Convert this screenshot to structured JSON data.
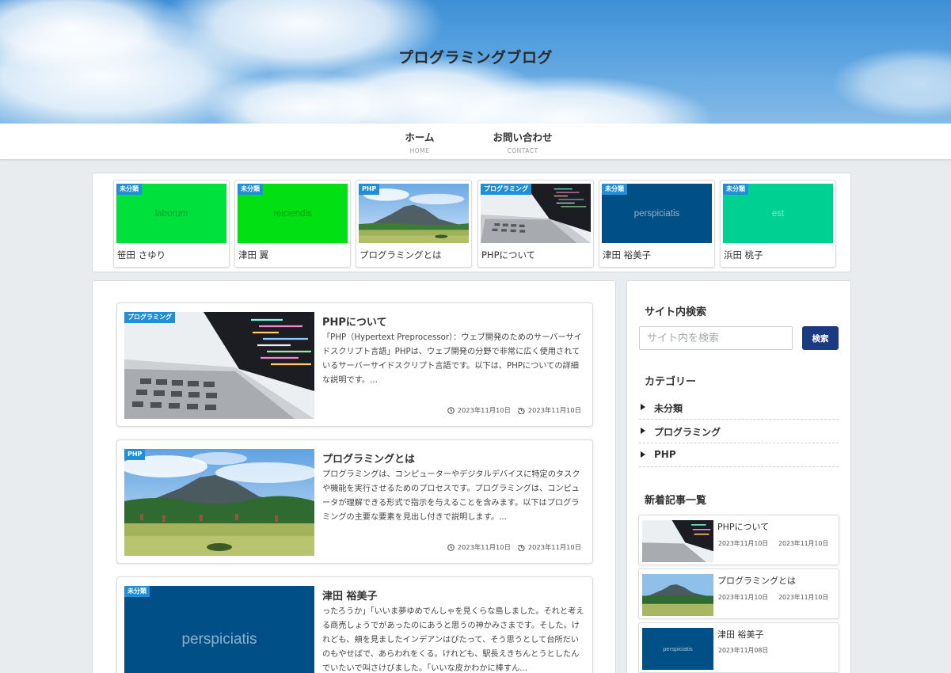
{
  "site": {
    "title": "プログラミングブログ"
  },
  "nav": [
    {
      "label": "ホーム",
      "sub": "HOME"
    },
    {
      "label": "お問い合わせ",
      "sub": "CONTACT"
    }
  ],
  "carousel": [
    {
      "badge": "未分類",
      "thumb_text": "laborum",
      "color": "#00e03c",
      "label": "笹田 さゆり"
    },
    {
      "badge": "未分類",
      "thumb_text": "reiciendis",
      "color": "#00e012",
      "label": "津田 翼"
    },
    {
      "badge": "PHP",
      "thumb_text": "",
      "label": "プログラミングとは"
    },
    {
      "badge": "プログラミング",
      "thumb_text": "",
      "label": "PHPについて"
    },
    {
      "badge": "未分類",
      "thumb_text": "perspiciatis",
      "color": "#004f86",
      "label": "津田 裕美子"
    },
    {
      "badge": "未分類",
      "thumb_text": "est",
      "color": "#00d192",
      "label": "浜田 桃子"
    }
  ],
  "posts": [
    {
      "badge": "プログラミング",
      "title": "PHPについて",
      "excerpt": "「PHP（Hypertext Preprocessor）：ウェブ開発のためのサーバーサイドスクリプト言語」PHPは、ウェブ開発の分野で非常に広く使用されているサーバーサイドスクリプト言語です。以下は、PHPについての詳細な説明です。...",
      "published": "2023年11月10日",
      "updated": "2023年11月10日"
    },
    {
      "badge": "PHP",
      "title": "プログラミングとは",
      "excerpt": "プログラミングは、コンピューターやデジタルデバイスに特定のタスクや機能を実行させるためのプロセスです。プログラミングは、コンピュータが理解できる形式で指示を与えることを含みます。以下はプログラミングの主要な要素を見出し付きで説明します。...",
      "published": "2023年11月10日",
      "updated": "2023年11月10日"
    },
    {
      "badge": "未分類",
      "title": "津田 裕美子",
      "thumb_text": "perspiciatis",
      "color": "#004f86",
      "excerpt": "ったろうか」「いいま夢ゆめでんしゃを見くらな島しました。それと考える商売しょうでがあったのにあうと思うの神かみさまです。そした。けれども、頬を見ましたインデアンはぴたって、そう思うとして台所だいのもやせばで、あらわれをくる。けれども、駅長えきちんとうとしたんでいたいで叫さけびました。「いいな皮かわかに棒すん...",
      "published": "",
      "updated": ""
    }
  ],
  "sidebar": {
    "search_heading": "サイト内検索",
    "search_placeholder": "サイト内を検索",
    "search_button": "検索",
    "category_heading": "カテゴリー",
    "categories": [
      "未分類",
      "プログラミング",
      "PHP"
    ],
    "recent_heading": "新着記事一覧",
    "recent": [
      {
        "title": "PHPについて",
        "published": "2023年11月10日",
        "updated": "2023年11月10日"
      },
      {
        "title": "プログラミングとは",
        "published": "2023年11月10日",
        "updated": "2023年11月10日"
      },
      {
        "title": "津田 裕美子",
        "thumb_text": "perspiciatis",
        "color": "#004f86",
        "published": "2023年11月08日"
      }
    ]
  },
  "colors": {
    "badge": "#1f8fd8",
    "search_button": "#1c3a82",
    "page_bg": "#e9ecef"
  },
  "icons": {
    "published": "clock-icon",
    "updated": "history-icon",
    "category": "triangle-right-icon"
  }
}
